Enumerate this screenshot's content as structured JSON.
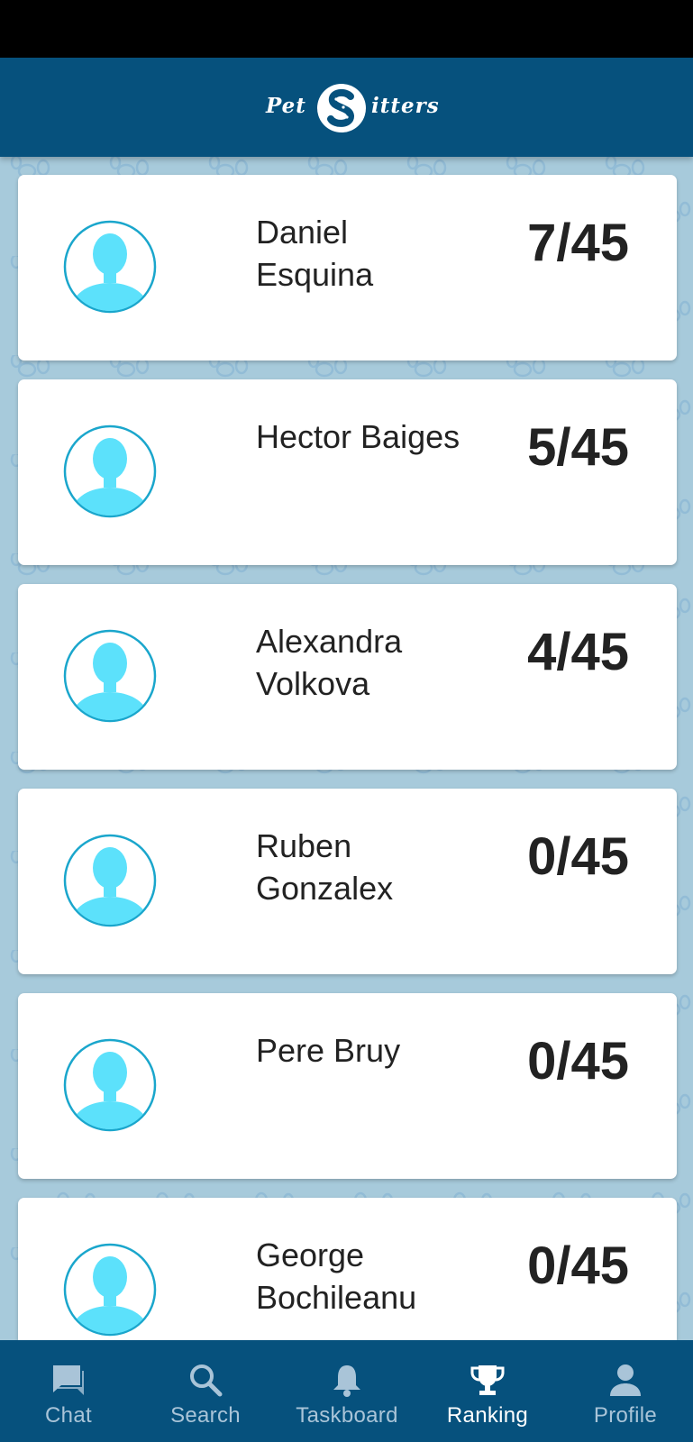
{
  "header": {
    "logo_left": "Pet",
    "logo_right": "itters"
  },
  "ranking": [
    {
      "name": "Daniel Esquina",
      "score": "7/45"
    },
    {
      "name": "Hector Baiges",
      "score": "5/45"
    },
    {
      "name": "Alexandra Volkova",
      "score": "4/45"
    },
    {
      "name": "Ruben Gonzalex",
      "score": "0/45"
    },
    {
      "name": "Pere Bruy",
      "score": "0/45"
    },
    {
      "name": "George Bochileanu",
      "score": "0/45"
    }
  ],
  "nav": {
    "items": [
      {
        "label": "Chat",
        "icon": "chat-icon"
      },
      {
        "label": "Search",
        "icon": "search-icon"
      },
      {
        "label": "Taskboard",
        "icon": "bell-icon"
      },
      {
        "label": "Ranking",
        "icon": "trophy-icon"
      },
      {
        "label": "Profile",
        "icon": "person-icon"
      }
    ],
    "active": "Ranking"
  },
  "colors": {
    "header": "#06517d",
    "background": "#a7cadb",
    "avatar": "#5ce1fb",
    "nav_inactive": "#a9c4d8",
    "nav_active": "#ffffff"
  }
}
